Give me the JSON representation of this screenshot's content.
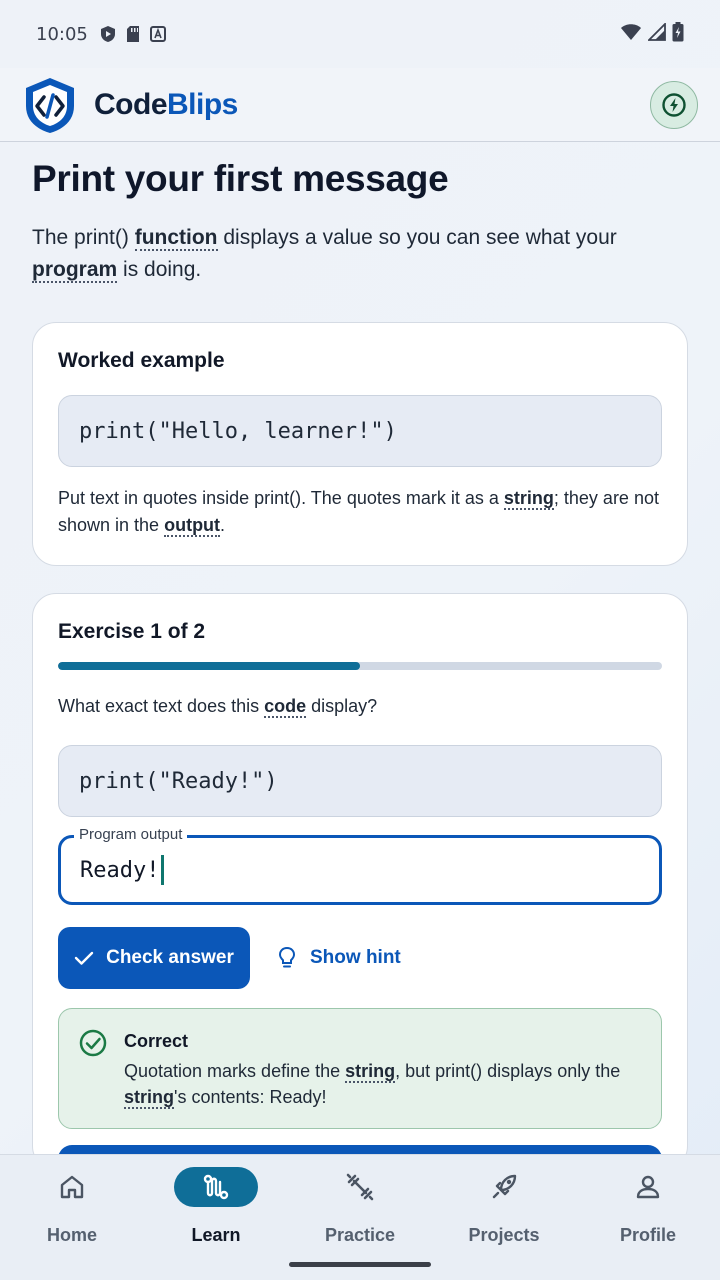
{
  "status_bar": {
    "time": "10:05"
  },
  "app": {
    "name_part1": "Code",
    "name_part2": "Blips"
  },
  "lesson": {
    "title": "Print your first message",
    "intro": [
      "The print() ",
      "function",
      " displays a value so you can see what your ",
      "program",
      " is doing."
    ]
  },
  "worked_example": {
    "heading": "Worked example",
    "code": "print(\"Hello, learner!\")",
    "note": [
      "Put text in quotes inside print(). The quotes mark it as a ",
      "string",
      "; they are not shown in the ",
      "output",
      "."
    ]
  },
  "exercise": {
    "title": "Exercise 1 of 2",
    "progress": 0.5,
    "question": [
      "What exact text does this ",
      "code",
      " display?"
    ],
    "code": "print(\"Ready!\")",
    "field_label": "Program output",
    "answer": "Ready!",
    "check_label": "Check answer",
    "hint_label": "Show hint",
    "feedback": {
      "title": "Correct",
      "text": [
        "Quotation marks define the ",
        "string",
        ", but print() displays only the ",
        "string",
        "'s contents: Ready!"
      ]
    }
  },
  "nav": [
    {
      "label": "Home",
      "icon": "home-icon",
      "active": false
    },
    {
      "label": "Learn",
      "icon": "route-icon",
      "active": true
    },
    {
      "label": "Practice",
      "icon": "dumbbell-icon",
      "active": false
    },
    {
      "label": "Projects",
      "icon": "rocket-icon",
      "active": false
    },
    {
      "label": "Profile",
      "icon": "person-icon",
      "active": false
    }
  ],
  "colors": {
    "primary": "#0b57b8",
    "accent": "#0f6e98",
    "success": "#1b7a45"
  }
}
